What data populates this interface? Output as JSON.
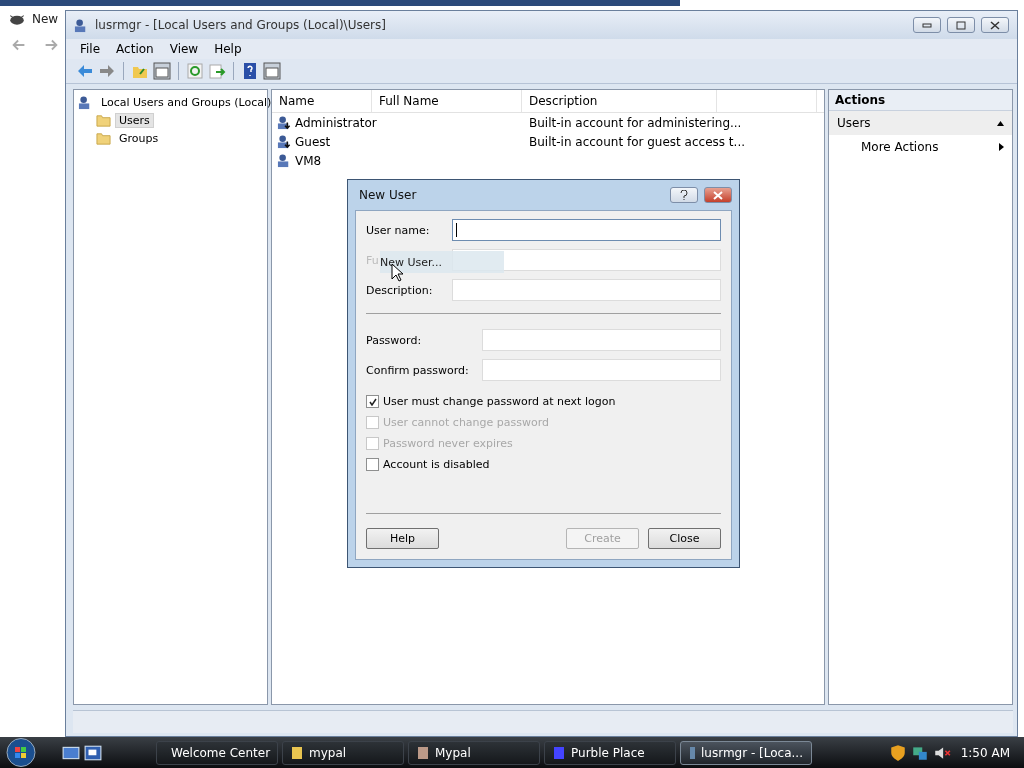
{
  "background_browser": {
    "tab_title": "New"
  },
  "window": {
    "title": "lusrmgr - [Local Users and Groups (Local)\\Users]"
  },
  "menu": [
    "File",
    "Action",
    "View",
    "Help"
  ],
  "tree": {
    "root": "Local Users and Groups (Local)",
    "children": [
      {
        "label": "Users",
        "selected": true
      },
      {
        "label": "Groups",
        "selected": false
      }
    ]
  },
  "list": {
    "columns": [
      "Name",
      "Full Name",
      "Description"
    ],
    "rows": [
      {
        "name": "Administrator",
        "description": "Built-in account for administering...",
        "disabled": true
      },
      {
        "name": "Guest",
        "description": "Built-in account for guest access t...",
        "disabled": true
      },
      {
        "name": "VM8",
        "description": "",
        "disabled": false
      }
    ]
  },
  "actions": {
    "title": "Actions",
    "section": "Users",
    "items": [
      "More Actions"
    ]
  },
  "dialog": {
    "title": "New User",
    "fields": [
      {
        "label": "User name:",
        "focused": true
      },
      {
        "label": "Fu",
        "focused": false
      },
      {
        "label": "Description:",
        "focused": false
      }
    ],
    "password_fields": [
      {
        "label": "Password:"
      },
      {
        "label": "Confirm password:"
      }
    ],
    "checkboxes": [
      {
        "label": "User must change password at next logon",
        "checked": true,
        "disabled": false
      },
      {
        "label": "User cannot change password",
        "checked": false,
        "disabled": true
      },
      {
        "label": "Password never expires",
        "checked": false,
        "disabled": true
      },
      {
        "label": "Account is disabled",
        "checked": false,
        "disabled": false
      }
    ],
    "buttons": [
      {
        "label": "Help",
        "disabled": false
      },
      {
        "label": "Create",
        "disabled": true
      },
      {
        "label": "Close",
        "disabled": false
      }
    ]
  },
  "drag_ghost": {
    "label": "New User..."
  },
  "taskbar": {
    "items": [
      {
        "label": "Welcome Center",
        "selected": false
      },
      {
        "label": "mypal",
        "selected": false
      },
      {
        "label": "Mypal",
        "selected": false
      },
      {
        "label": "Purble Place",
        "selected": false
      },
      {
        "label": "lusrmgr - [Loca...",
        "selected": true
      }
    ],
    "clock": "1:50 AM"
  }
}
